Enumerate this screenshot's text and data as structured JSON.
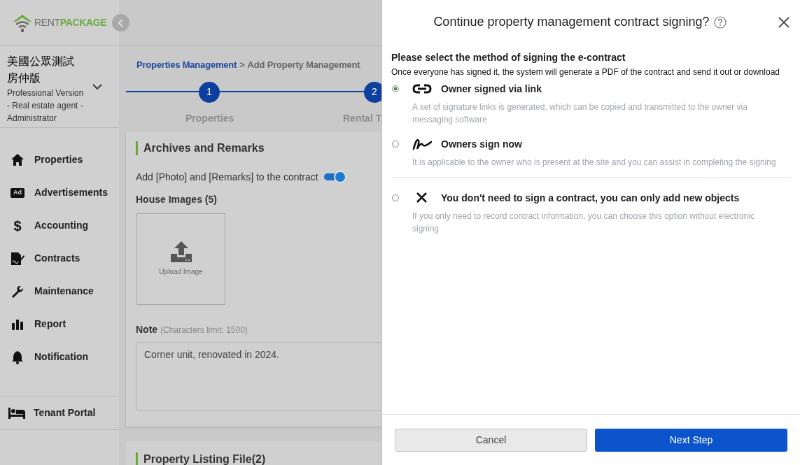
{
  "brand": {
    "word_1": "RENT",
    "word_2": "PACKAGE"
  },
  "account": {
    "name": "美國公眾測試房仲版",
    "role": "Professional Version - Real estate agent - Administrator"
  },
  "nav": [
    {
      "label": "Properties"
    },
    {
      "label": "Advertisements",
      "icon_text": "Ad"
    },
    {
      "label": "Accounting",
      "icon_text": "$"
    },
    {
      "label": "Contracts"
    },
    {
      "label": "Maintenance"
    },
    {
      "label": "Report"
    },
    {
      "label": "Notification"
    }
  ],
  "tenant_portal": {
    "label": "Tenant Portal"
  },
  "breadcrumb": {
    "parent": "Properties Management",
    "separator": ">",
    "current": "Add Property Management"
  },
  "steps": [
    {
      "number": "1",
      "label": "Properties"
    },
    {
      "number": "2",
      "label": "Rental T"
    }
  ],
  "archives_card": {
    "title": "Archives and Remarks",
    "toggle_label": "Add [Photo] and [Remarks] to the contract",
    "toggle_on": true,
    "images_label": "House Images (5)",
    "upload_label": "Upload Image",
    "note_label": "Note",
    "note_hint": "(Characters limit: 1500)",
    "note_value": "Corner unit, renovated in 2024."
  },
  "next_card": {
    "title": "Property Listing File(2)"
  },
  "dialog": {
    "title": "Continue property management contract signing?",
    "heading": "Please select the method of signing the e-contract",
    "subheading": "Once everyone has signed it, the system will generate a PDF of the contract and send it out or download",
    "options": [
      {
        "kind": "link",
        "title": "Owner signed via link",
        "description": "A set of signature links is generated, which can be copied and transmitted to the owner via messaging software",
        "selected": true
      },
      {
        "kind": "signature",
        "title": "Owners sign now",
        "description": "It is applicable to the owner who is present at the site and you can assist in completing the signing",
        "selected": false
      },
      {
        "kind": "none",
        "title": "You don't need to sign a contract, you can only add new objects",
        "description": "If you only need to record contract information, you can choose this option without electronic signing",
        "selected": false
      }
    ],
    "cancel_button": "Cancel",
    "next_button": "Next Step"
  }
}
